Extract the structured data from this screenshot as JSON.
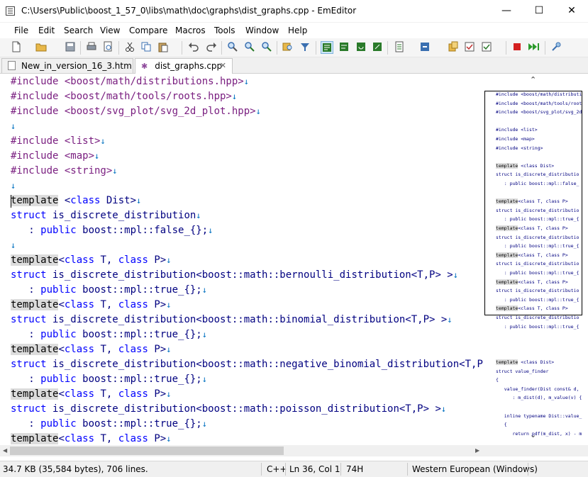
{
  "window": {
    "title": "C:\\Users\\Public\\boost_1_57_0\\libs\\math\\doc\\graphs\\dist_graphs.cpp - EmEditor",
    "minimize_glyph": "—",
    "maximize_glyph": "☐",
    "close_glyph": "✕"
  },
  "menu": [
    "File",
    "Edit",
    "Search",
    "View",
    "Compare",
    "Macros",
    "Tools",
    "Window",
    "Help"
  ],
  "toolbar": {
    "icons": [
      "new-file-icon",
      "open-folder-icon",
      "save-icon",
      "print-icon",
      "print-preview-icon",
      "cut-icon",
      "copy-icon",
      "paste-icon",
      "undo-icon",
      "redo-icon",
      "find-icon",
      "find-next-icon",
      "find-prev-icon",
      "find-in-files-icon",
      "filter-icon",
      "word-wrap-icon",
      "wrap-window-icon",
      "wrap-page-icon",
      "fullscreen-icon",
      "config-icon",
      "encoding-icon",
      "plugin-icon",
      "bookmark-icon",
      "record-macro-icon",
      "run-macro-icon",
      "tools-icon"
    ],
    "accent": "#2a7a2a"
  },
  "tabs": [
    {
      "label": "New_in_version_16_3.htm *",
      "active": false
    },
    {
      "label": "dist_graphs.cpp",
      "active": true
    }
  ],
  "tab_close_glyph": "✕",
  "code": {
    "newline_glyph": "↓",
    "lines": [
      [
        [
          "pp",
          "#include "
        ],
        [
          "pp",
          "<boost/math/distributions.hpp>"
        ]
      ],
      [
        [
          "pp",
          "#include "
        ],
        [
          "pp",
          "<boost/math/tools/roots.hpp>"
        ]
      ],
      [
        [
          "pp",
          "#include "
        ],
        [
          "pp",
          "<boost/svg_plot/svg_2d_plot.hpp>"
        ]
      ],
      [],
      [
        [
          "pp",
          "#include "
        ],
        [
          "pp",
          "<list>"
        ]
      ],
      [
        [
          "pp",
          "#include "
        ],
        [
          "pp",
          "<map>"
        ]
      ],
      [
        [
          "pp",
          "#include "
        ],
        [
          "pp",
          "<string>"
        ]
      ],
      [],
      [
        [
          "hl",
          "template"
        ],
        [
          "pl",
          " <"
        ],
        [
          "kw",
          "class"
        ],
        [
          "pl",
          " Dist>"
        ]
      ],
      [
        [
          "kw",
          "struct"
        ],
        [
          "pl",
          " is_discrete_distribution"
        ]
      ],
      [
        [
          "pl",
          "   : "
        ],
        [
          "kw",
          "public"
        ],
        [
          "pl",
          " boost::mpl::false_{};"
        ]
      ],
      [],
      [
        [
          "hl",
          "template"
        ],
        [
          "pl",
          "<"
        ],
        [
          "kw",
          "class"
        ],
        [
          "pl",
          " T, "
        ],
        [
          "kw",
          "class"
        ],
        [
          "pl",
          " P>"
        ]
      ],
      [
        [
          "kw",
          "struct"
        ],
        [
          "pl",
          " is_discrete_distribution<boost::math::bernoulli_distribution<T,P> >"
        ]
      ],
      [
        [
          "pl",
          "   : "
        ],
        [
          "kw",
          "public"
        ],
        [
          "pl",
          " boost::mpl::true_{};"
        ]
      ],
      [
        [
          "hl",
          "template"
        ],
        [
          "pl",
          "<"
        ],
        [
          "kw",
          "class"
        ],
        [
          "pl",
          " T, "
        ],
        [
          "kw",
          "class"
        ],
        [
          "pl",
          " P>"
        ]
      ],
      [
        [
          "kw",
          "struct"
        ],
        [
          "pl",
          " is_discrete_distribution<boost::math::binomial_distribution<T,P> >"
        ]
      ],
      [
        [
          "pl",
          "   : "
        ],
        [
          "kw",
          "public"
        ],
        [
          "pl",
          " boost::mpl::true_{};"
        ]
      ],
      [
        [
          "hl",
          "template"
        ],
        [
          "pl",
          "<"
        ],
        [
          "kw",
          "class"
        ],
        [
          "pl",
          " T, "
        ],
        [
          "kw",
          "class"
        ],
        [
          "pl",
          " P>"
        ]
      ],
      [
        [
          "kw",
          "struct"
        ],
        [
          "pl",
          " is_discrete_distribution<boost::math::negative_binomial_distribution<T,P> >"
        ]
      ],
      [
        [
          "pl",
          "   : "
        ],
        [
          "kw",
          "public"
        ],
        [
          "pl",
          " boost::mpl::true_{};"
        ]
      ],
      [
        [
          "hl",
          "template"
        ],
        [
          "pl",
          "<"
        ],
        [
          "kw",
          "class"
        ],
        [
          "pl",
          " T, "
        ],
        [
          "kw",
          "class"
        ],
        [
          "pl",
          " P>"
        ]
      ],
      [
        [
          "kw",
          "struct"
        ],
        [
          "pl",
          " is_discrete_distribution<boost::math::poisson_distribution<T,P> >"
        ]
      ],
      [
        [
          "pl",
          "   : "
        ],
        [
          "kw",
          "public"
        ],
        [
          "pl",
          " boost::mpl::true_{};"
        ]
      ],
      [
        [
          "hl",
          "template"
        ],
        [
          "pl",
          "<"
        ],
        [
          "kw",
          "class"
        ],
        [
          "pl",
          " T, "
        ],
        [
          "kw",
          "class"
        ],
        [
          "pl",
          " P>"
        ]
      ]
    ]
  },
  "minimap": {
    "up_glyph": "⌃",
    "down_glyph": "⌄",
    "lines": [
      "#include <boost/math/distributi",
      "#include <boost/math/tools/root",
      "#include <boost/svg_plot/svg_2d",
      "",
      "#include <list>",
      "#include <map>",
      "#include <string>",
      "",
      "template <class Dist>",
      "struct is_discrete_distributio",
      "   : public boost::mpl::false_",
      "",
      "template<class T, class P>",
      "struct is_discrete_distributio",
      "   : public boost::mpl::true_{",
      "template<class T, class P>",
      "struct is_discrete_distributio",
      "   : public boost::mpl::true_{",
      "template<class T, class P>",
      "struct is_discrete_distributio",
      "   : public boost::mpl::true_{",
      "template<class T, class P>",
      "struct is_discrete_distributio",
      "   : public boost::mpl::true_{",
      "template<class T, class P>",
      "struct is_discrete_distributio",
      "   : public boost::mpl::true_{",
      "",
      "",
      "",
      "template <class Dist>",
      "struct value_finder",
      "{",
      "   value_finder(Dist const& d,",
      "      : m_dist(d), m_value(v) {",
      "",
      "   inline typename Dist::value_",
      "   {",
      "      return pdf(m_dist, x) - m"
    ]
  },
  "status": {
    "size": "34.7 KB (35,584 bytes), 706 lines.",
    "language": "C++",
    "position": "Ln 36, Col 1",
    "char_code": "74H",
    "encoding": "Western European (Windows)"
  }
}
